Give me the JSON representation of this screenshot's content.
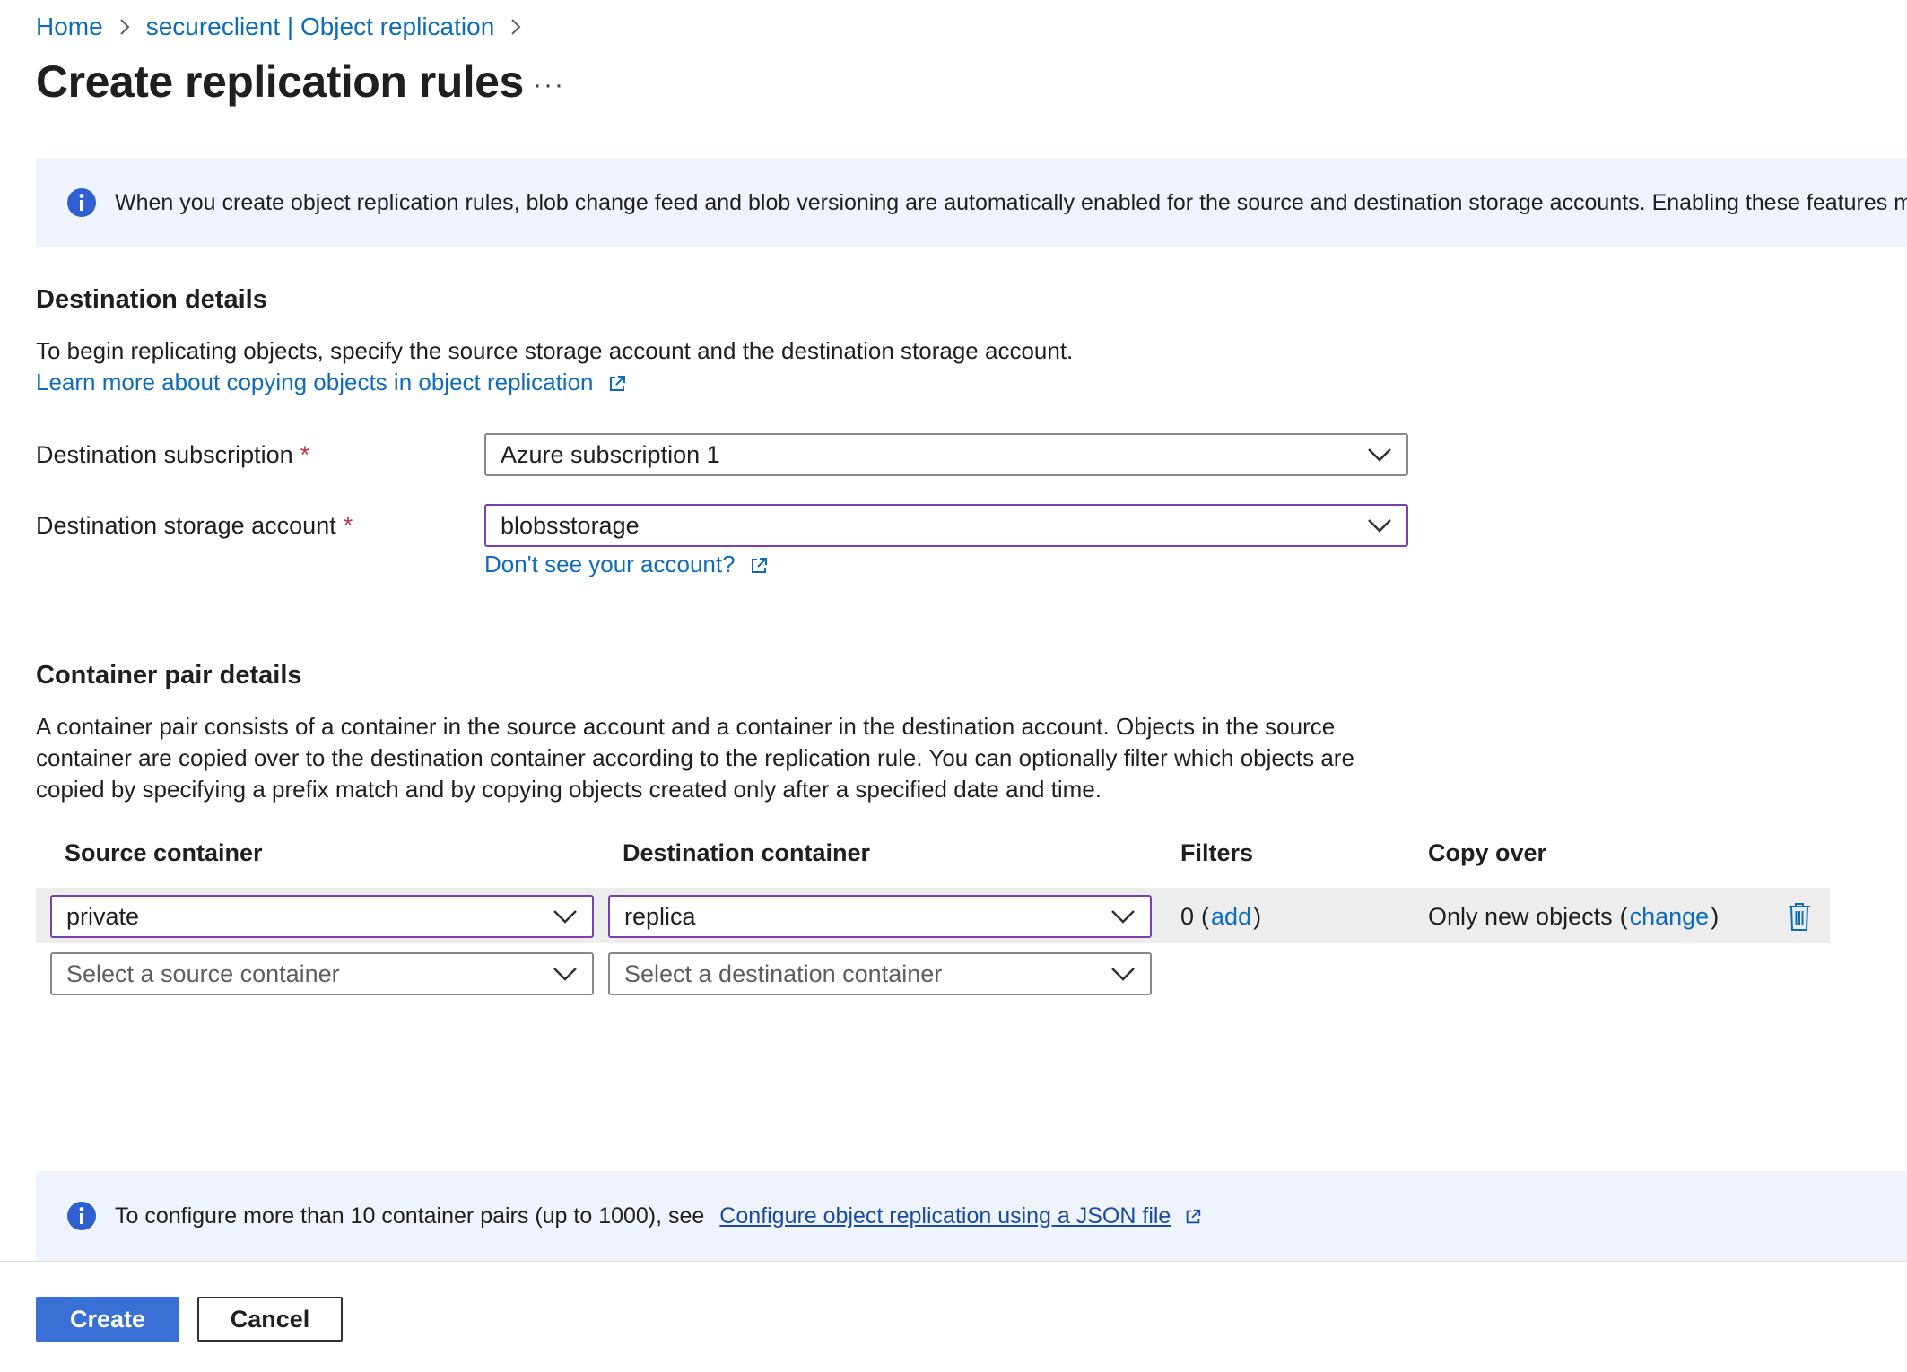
{
  "breadcrumb": {
    "items": [
      "Home",
      "secureclient | Object replication"
    ]
  },
  "page": {
    "title": "Create replication rules",
    "more_label": "···"
  },
  "top_info": {
    "text": "When you create object replication rules, blob change feed and blob versioning are automatically enabled for the source and destination storage accounts. Enabling these features may increa"
  },
  "destination": {
    "section_title": "Destination details",
    "description": "To begin replicating objects, specify the source storage account and the destination storage account.",
    "learn_more": "Learn more about copying objects in object replication",
    "subscription_label": "Destination subscription",
    "subscription_value": "Azure subscription 1",
    "storage_label": "Destination storage account",
    "storage_value": "blobsstorage",
    "required_marker": "*",
    "dont_see_account": "Don't see your account?"
  },
  "container_pairs": {
    "section_title": "Container pair details",
    "description": "A container pair consists of a container in the source account and a container in the destination account. Objects in the source container are copied over to the destination container according to the replication rule. You can optionally filter which objects are copied by specifying a prefix match and by copying objects created only after a specified date and time.",
    "columns": [
      "Source container",
      "Destination container",
      "Filters",
      "Copy over"
    ],
    "rows": [
      {
        "source": "private",
        "destination": "replica",
        "filters_count": "0",
        "filters_link": "add",
        "copy_over": "Only new objects",
        "copy_over_link": "change"
      }
    ],
    "empty_row": {
      "source_placeholder": "Select a source container",
      "destination_placeholder": "Select a destination container"
    }
  },
  "bottom_info": {
    "text": "To configure more than 10 container pairs (up to 1000), see",
    "link": "Configure object replication using a JSON file"
  },
  "actions": {
    "create": "Create",
    "cancel": "Cancel"
  },
  "colors": {
    "link": "#0f6cbd",
    "primary_button": "#3a6fd6",
    "focus_border": "#7b3fb1",
    "required": "#c4314b",
    "info_bg": "#eef3fc"
  }
}
